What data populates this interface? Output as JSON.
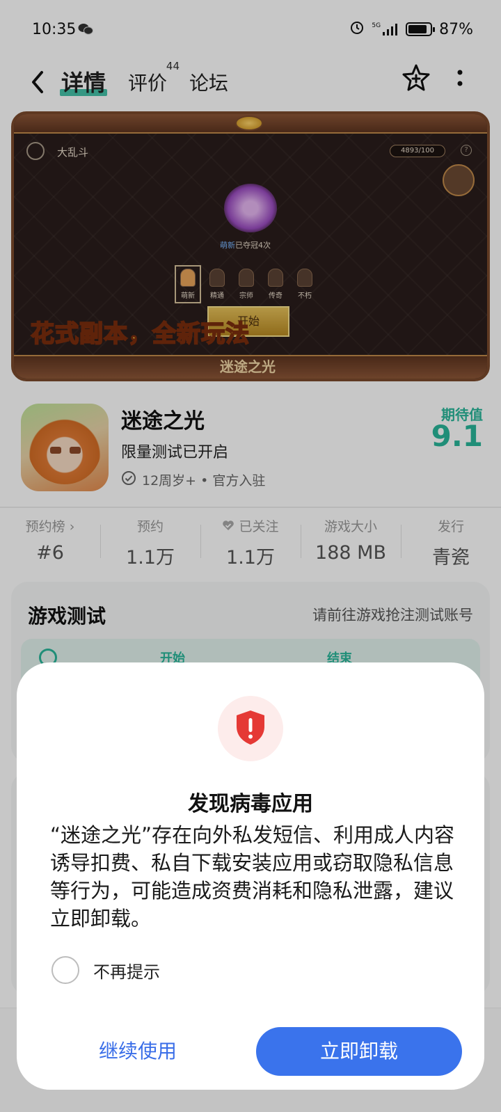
{
  "status_bar": {
    "time": "10:35",
    "network": "5G",
    "battery": "87%",
    "battery_level": 0.87
  },
  "nav": {
    "tabs": [
      {
        "label": "详情",
        "active": true
      },
      {
        "label": "评价",
        "badge": "44"
      },
      {
        "label": "论坛"
      }
    ]
  },
  "banner": {
    "mode_label": "大乱斗",
    "energy": "4893/100",
    "help": "?",
    "champion_name": "萌新",
    "champion_text": "已夺冠4次",
    "ranks": [
      "萌新",
      "精通",
      "宗师",
      "传奇",
      "不朽"
    ],
    "start_button": "开始",
    "slogan": "花式副本，全新玩法",
    "logo": "迷途之光"
  },
  "app": {
    "name": "迷途之光",
    "tagline": "限量测试已开启",
    "meta": "12周岁+ • 官方入驻",
    "score_label": "期待值",
    "score": "9.1"
  },
  "stats": [
    {
      "label": "预约榜 ›",
      "value": "#6"
    },
    {
      "label": "预约",
      "value": "1.1万"
    },
    {
      "label": "已关注",
      "value": "1.1万"
    },
    {
      "label": "游戏大小",
      "value": "188 MB"
    },
    {
      "label": "发行",
      "value": "青瓷"
    }
  ],
  "test_card": {
    "title": "游戏测试",
    "hint": "请前往游戏抢注测试账号",
    "col_start": "开始",
    "col_end": "结束"
  },
  "dialog": {
    "title": "发现病毒应用",
    "message": "“迷途之光”存在向外私发短信、利用成人内容诱导扣费、私自下载安装应用或窃取隐私信息等行为，可能造成资费消耗和隐私泄露，建议立即卸载。",
    "dont_show": "不再提示",
    "continue": "继续使用",
    "uninstall": "立即卸载"
  },
  "colors": {
    "accent_green": "#2ab79a",
    "primary_blue": "#3a73ec",
    "danger_red": "#e53935"
  }
}
